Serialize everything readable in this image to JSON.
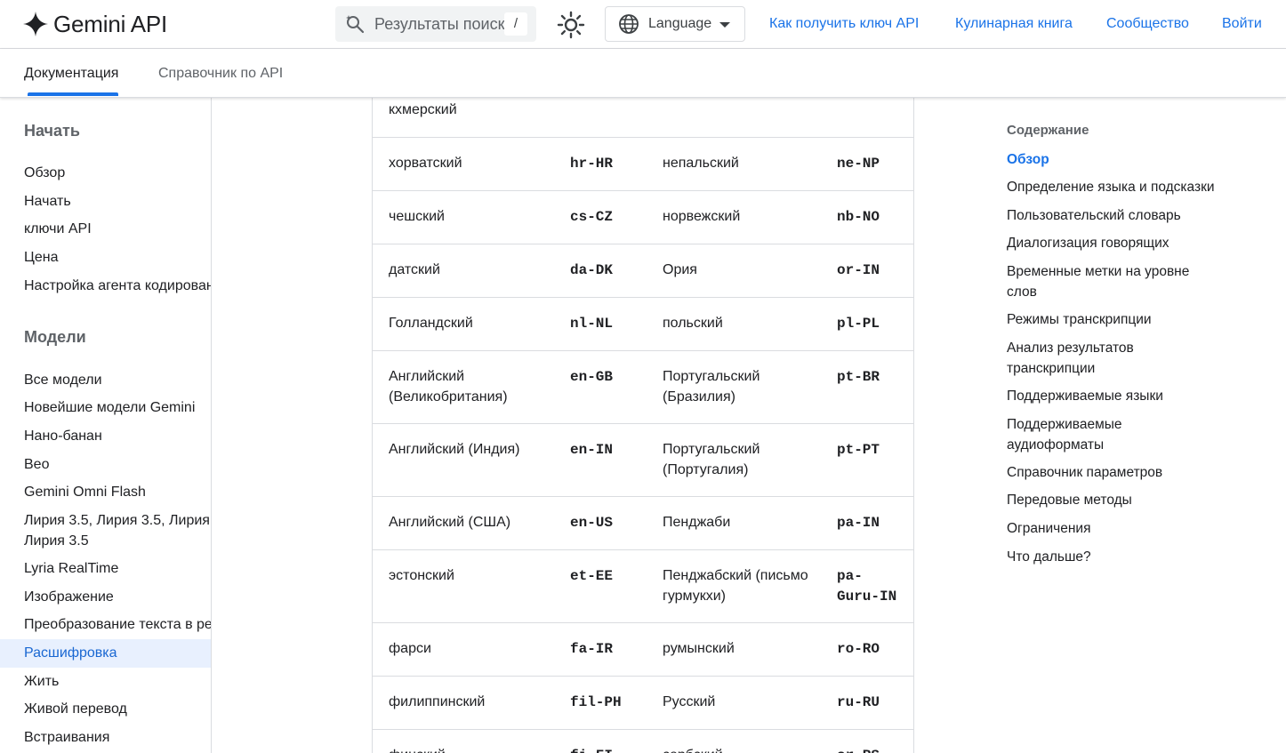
{
  "header": {
    "logo_text": "Gemini API",
    "search_placeholder": "Результаты поиск",
    "search_shortcut": "/",
    "language_label": "Language",
    "links": [
      {
        "label": "Как получить ключ API"
      },
      {
        "label": "Кулинарная книга"
      },
      {
        "label": "Сообщество"
      },
      {
        "label": "Войти"
      }
    ],
    "brand_color": "#1a73e8"
  },
  "tabs": [
    {
      "label": "Документация",
      "active": true
    },
    {
      "label": "Справочник по API",
      "active": false
    }
  ],
  "sidebar": {
    "sections": [
      {
        "heading": "Начать",
        "items": [
          "Обзор",
          "Начать",
          "ключи API",
          "Цена",
          "Настройка агента кодировани"
        ]
      },
      {
        "heading": "Модели",
        "items": [
          "Все модели",
          "Новейшие модели Gemini",
          "Нано-банан",
          "Вео",
          "Gemini Omni Flash",
          "Лирия 3.5, Лирия 3.5, Лирия Лирия 3.5",
          "Lyria RealTime",
          "Изображение",
          "Преобразование текста в ре",
          "Расшифровка",
          "Жить",
          "Живой перевод",
          "Встраивания"
        ]
      }
    ],
    "active_item": "Расшифровка"
  },
  "languages_table": {
    "partial_top": "кхмерский",
    "rows": [
      {
        "name1": "хорватский",
        "code1": "hr-HR",
        "name2": "непальский",
        "code2": "ne-NP"
      },
      {
        "name1": "чешский",
        "code1": "cs-CZ",
        "name2": "норвежский",
        "code2": "nb-NO"
      },
      {
        "name1": "датский",
        "code1": "da-DK",
        "name2": "Ория",
        "code2": "or-IN"
      },
      {
        "name1": "Голландский",
        "code1": "nl-NL",
        "name2": "польский",
        "code2": "pl-PL"
      },
      {
        "name1": "Английский (Великобритания)",
        "code1": "en-GB",
        "name2": "Португальский (Бразилия)",
        "code2": "pt-BR"
      },
      {
        "name1": "Английский (Индия)",
        "code1": "en-IN",
        "name2": "Португальский (Португалия)",
        "code2": "pt-PT"
      },
      {
        "name1": "Английский (США)",
        "code1": "en-US",
        "name2": "Пенджаби",
        "code2": "pa-IN"
      },
      {
        "name1": "эстонский",
        "code1": "et-EE",
        "name2": "Пенджабский (письмо гурмукхи)",
        "code2": "pa-Guru-IN"
      },
      {
        "name1": "фарси",
        "code1": "fa-IR",
        "name2": "румынский",
        "code2": "ro-RO"
      },
      {
        "name1": "филиппинский",
        "code1": "fil-PH",
        "name2": "Русский",
        "code2": "ru-RU"
      },
      {
        "name1": "финский",
        "code1": "fi-FI",
        "name2": "сербский",
        "code2": "sr-RS"
      }
    ]
  },
  "toc": {
    "heading": "Содержание",
    "items": [
      {
        "label": "Обзор",
        "active": true
      },
      {
        "label": "Определение языка и подсказки"
      },
      {
        "label": "Пользовательский словарь"
      },
      {
        "label": "Диалогизация говорящих"
      },
      {
        "label": "Временные метки на уровне слов"
      },
      {
        "label": "Режимы транскрипции"
      },
      {
        "label": "Анализ результатов транскрипции"
      },
      {
        "label": "Поддерживаемые языки"
      },
      {
        "label": "Поддерживаемые аудиоформаты"
      },
      {
        "label": "Справочник параметров"
      },
      {
        "label": "Передовые методы"
      },
      {
        "label": "Ограничения"
      },
      {
        "label": "Что дальше?"
      }
    ]
  }
}
